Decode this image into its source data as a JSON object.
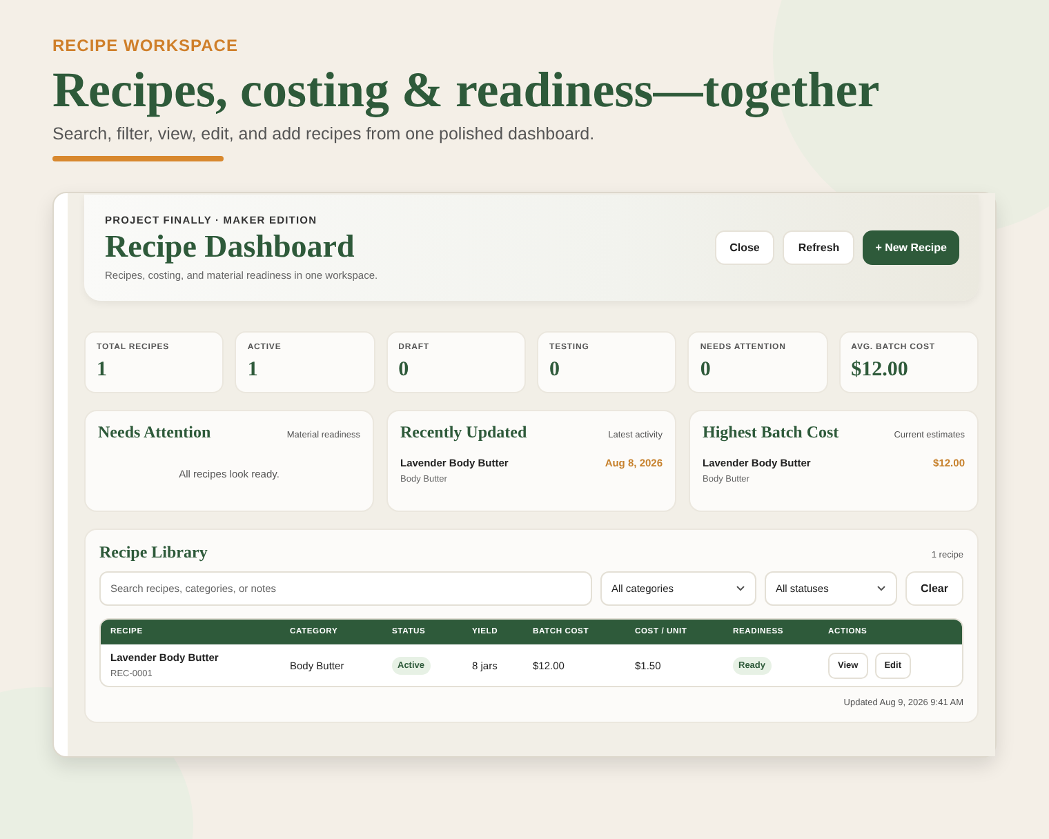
{
  "hero": {
    "eyebrow": "RECIPE WORKSPACE",
    "title": "Recipes, costing & readiness—together",
    "subtitle": "Search, filter, view, edit, and add recipes from one polished dashboard."
  },
  "header": {
    "eyebrow": "PROJECT FINALLY · MAKER EDITION",
    "title": "Recipe Dashboard",
    "subtitle": "Recipes, costing, and material readiness in one workspace.",
    "buttons": [
      {
        "label": "Close",
        "kind": "plain"
      },
      {
        "label": "Refresh",
        "kind": "plain"
      },
      {
        "label": "+ New Recipe",
        "kind": "primary"
      }
    ]
  },
  "stats": [
    {
      "label": "TOTAL RECIPES",
      "value": "1"
    },
    {
      "label": "ACTIVE",
      "value": "1"
    },
    {
      "label": "DRAFT",
      "value": "0"
    },
    {
      "label": "TESTING",
      "value": "0"
    },
    {
      "label": "NEEDS ATTENTION",
      "value": "0"
    },
    {
      "label": "AVG. BATCH COST",
      "value": "$12.00"
    }
  ],
  "panels": [
    {
      "title": "Needs Attention",
      "note": "Material readiness",
      "empty": "All recipes look ready."
    },
    {
      "title": "Recently Updated",
      "note": "Latest activity",
      "items": [
        {
          "name": "Lavender Body Butter",
          "sub": "Body Butter",
          "value": "Aug 8, 2026"
        }
      ]
    },
    {
      "title": "Highest Batch Cost",
      "note": "Current estimates",
      "items": [
        {
          "name": "Lavender Body Butter",
          "sub": "Body Butter",
          "value": "$12.00"
        }
      ]
    }
  ],
  "library": {
    "title": "Recipe Library",
    "count": "1 recipe",
    "search": {
      "placeholder": "Search recipes, categories, or notes"
    },
    "filters": [
      "All categories",
      "All statuses"
    ],
    "clear": "Clear",
    "table": {
      "columns": [
        "RECIPE",
        "CATEGORY",
        "STATUS",
        "YIELD",
        "BATCH COST",
        "COST / UNIT",
        "READINESS",
        "ACTIONS"
      ],
      "rows": [
        {
          "name": "Lavender Body Butter",
          "id": "REC-0001",
          "category": "Body Butter",
          "status": "Active",
          "yield": "8 jars",
          "batch_cost": "$12.00",
          "unit_cost": "$1.50",
          "readiness": "Ready",
          "actions": [
            "View",
            "Edit"
          ]
        }
      ]
    },
    "updated": "Updated Aug 9, 2026 9:41 AM"
  }
}
